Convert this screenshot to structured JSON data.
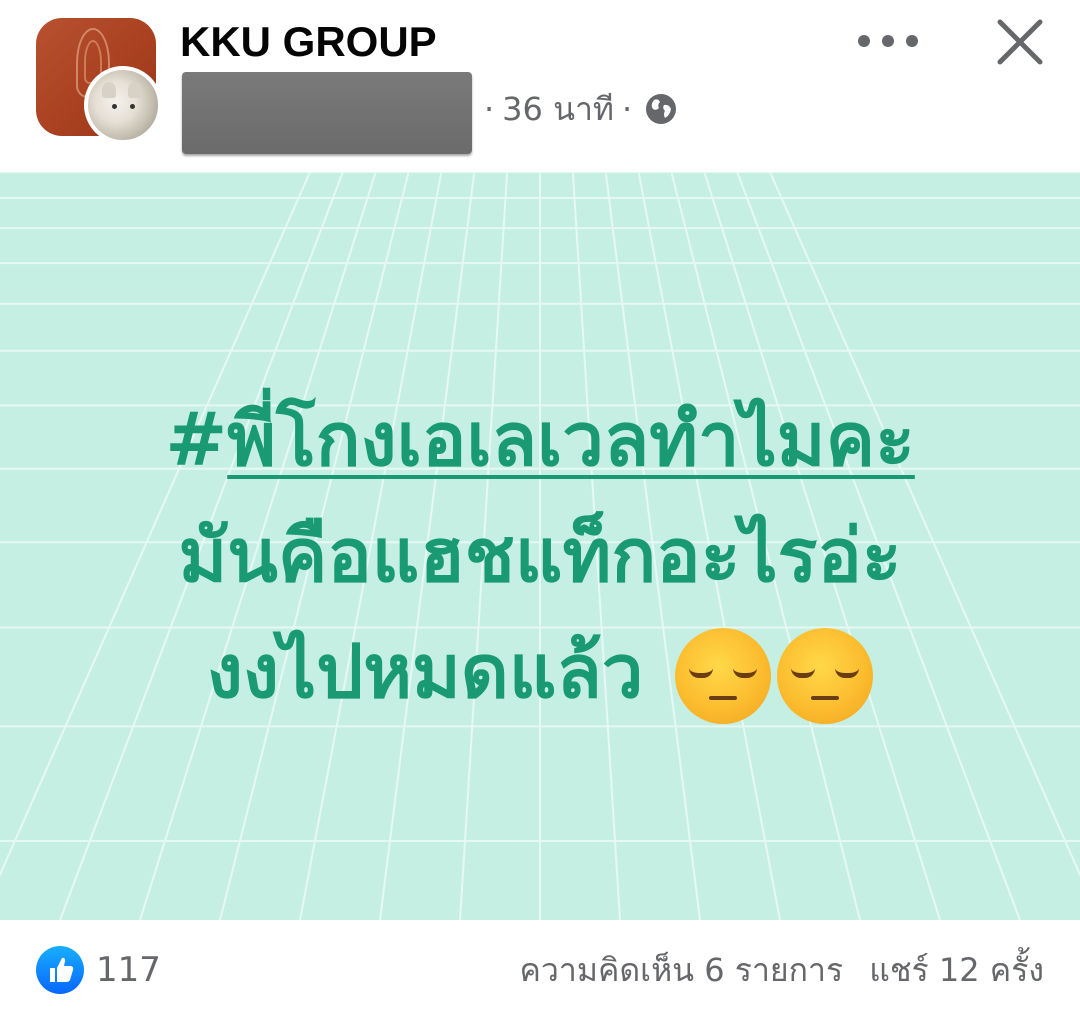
{
  "post": {
    "group_name": "KKU GROUP",
    "time": "36 นาที",
    "dot": "·",
    "privacy_icon": "globe-icon",
    "background_color": "#c6efe4",
    "text_color": "#1a9a72",
    "hashtag_prefix": "#",
    "hashtag": "พี่โกงเอเลเวลทำไมคะ",
    "line2": "มันคือแฮชแท็กอะไรอ่ะ",
    "line3": "งงไปหมดแล้ว",
    "emoji": "pensive-face-emoji"
  },
  "actions": {
    "more_icon": "more-icon",
    "close_icon": "close-icon"
  },
  "footer": {
    "reaction_icon": "like-icon",
    "like_count": "117",
    "comments": "ความคิดเห็น 6 รายการ",
    "shares": "แชร์ 12 ครั้ง",
    "accent_color": "#0866ff"
  }
}
